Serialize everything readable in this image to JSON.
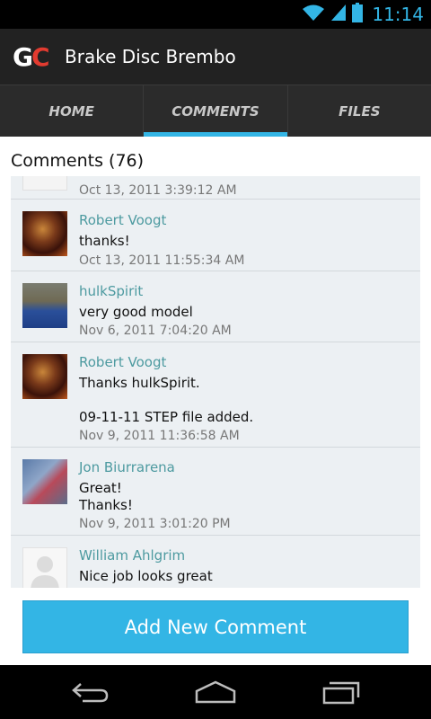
{
  "status_bar": {
    "time": "11:14",
    "icons": [
      "wifi-icon",
      "signal-icon",
      "battery-icon"
    ]
  },
  "app_bar": {
    "logo_g": "G",
    "logo_c": "C",
    "title": "Brake Disc Brembo"
  },
  "tabs": [
    {
      "label": "HOME",
      "active": false
    },
    {
      "label": "COMMENTS",
      "active": true
    },
    {
      "label": "FILES",
      "active": false
    }
  ],
  "comments": {
    "header": "Comments (76)",
    "items": [
      {
        "author": "",
        "text": "",
        "date": "Oct 13, 2011 3:39:12 AM"
      },
      {
        "author": "Robert Voogt",
        "text": "thanks!",
        "date": "Oct 13, 2011 11:55:34 AM"
      },
      {
        "author": "hulkSpirit",
        "text": "very good model",
        "date": "Nov 6, 2011 7:04:20 AM"
      },
      {
        "author": "Robert Voogt",
        "text": "Thanks hulkSpirit.\n\n09-11-11 STEP file added.",
        "date": "Nov 9, 2011 11:36:58 AM"
      },
      {
        "author": "Jon Biurrarena",
        "text": "Great!\nThanks!",
        "date": "Nov 9, 2011 3:01:20 PM"
      },
      {
        "author": "William Ahlgrim",
        "text": "Nice job looks great",
        "date": ""
      }
    ]
  },
  "add_button": {
    "label": "Add New Comment"
  },
  "colors": {
    "accent": "#33b5e5",
    "author": "#4d9aa0",
    "logo_red": "#e23b30"
  },
  "nav": [
    "back-icon",
    "home-icon",
    "recent-apps-icon"
  ]
}
